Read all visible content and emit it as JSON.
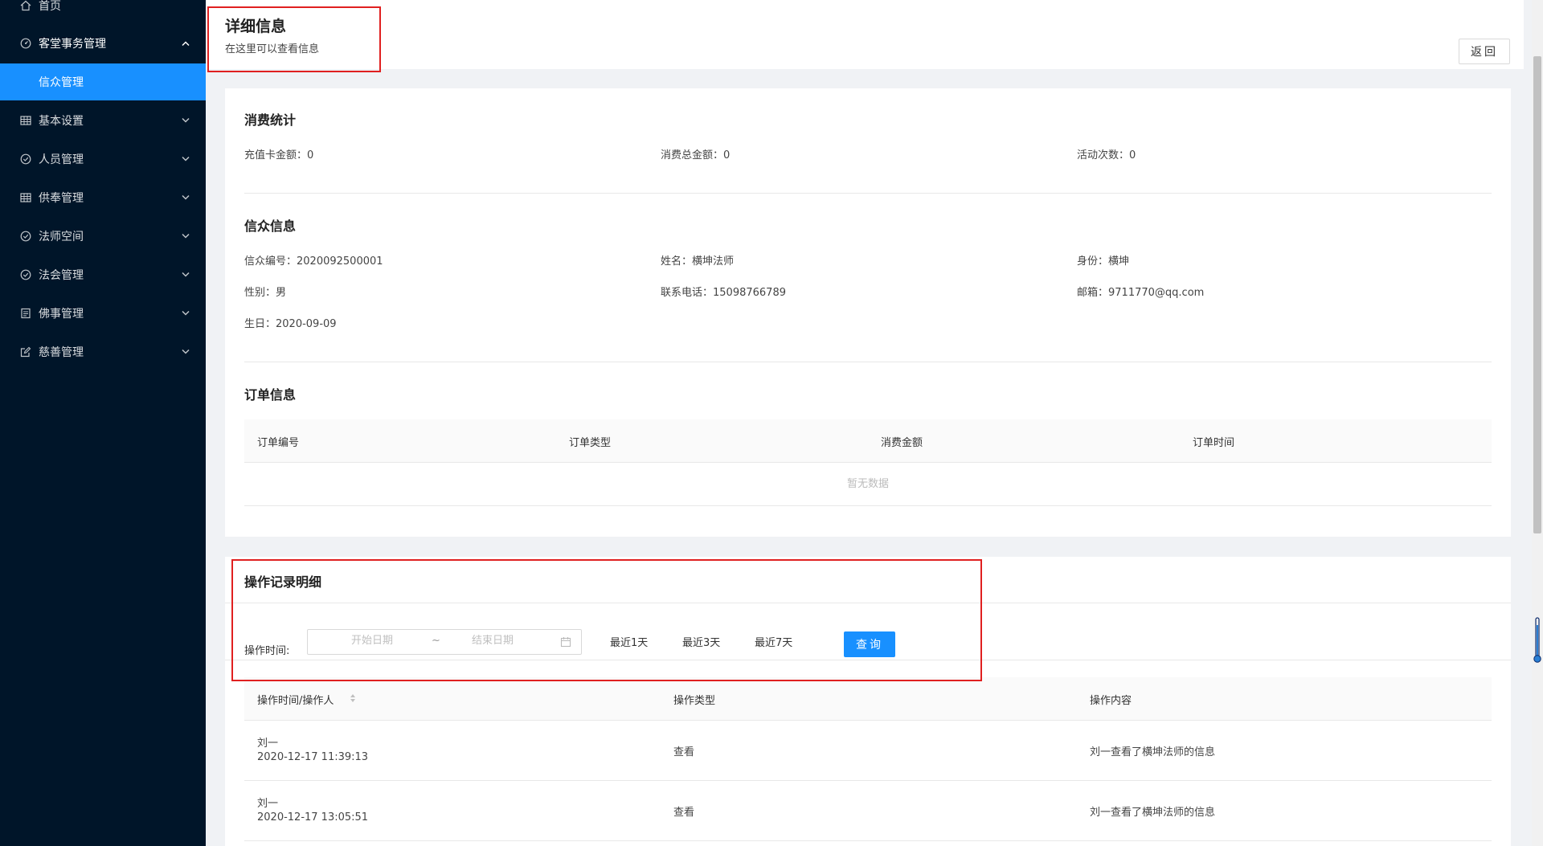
{
  "sidebar": {
    "items": [
      {
        "label": "首页",
        "icon": "home-icon"
      },
      {
        "label": "客堂事务管理",
        "icon": "dashboard-icon"
      },
      {
        "label": "信众管理"
      },
      {
        "label": "基本设置",
        "icon": "table-icon"
      },
      {
        "label": "人员管理",
        "icon": "check-circle-icon"
      },
      {
        "label": "供奉管理",
        "icon": "table-icon"
      },
      {
        "label": "法师空间",
        "icon": "check-circle-icon"
      },
      {
        "label": "法会管理",
        "icon": "check-circle-icon"
      },
      {
        "label": "佛事管理",
        "icon": "profile-icon"
      },
      {
        "label": "慈善管理",
        "icon": "form-icon"
      }
    ]
  },
  "header": {
    "title": "详细信息",
    "subtitle": "在这里可以查看信息",
    "back_label": "返回"
  },
  "consumption": {
    "title": "消费统计",
    "recharge_label": "充值卡金额：",
    "recharge_value": "0",
    "total_label": "消费总金额：",
    "total_value": "0",
    "activity_label": "活动次数：",
    "activity_value": "0"
  },
  "believer": {
    "title": "信众信息",
    "id_label": "信众编号：",
    "id_value": "2020092500001",
    "name_label": "姓名：",
    "name_value": "横坤法师",
    "identity_label": "身份：",
    "identity_value": "横坤",
    "gender_label": "性别：",
    "gender_value": "男",
    "phone_label": "联系电话：",
    "phone_value": "15098766789",
    "email_label": "邮箱：",
    "email_value": "9711770@qq.com",
    "birthday_label": "生日：",
    "birthday_value": "2020-09-09"
  },
  "orders": {
    "title": "订单信息",
    "columns": [
      "订单编号",
      "订单类型",
      "消费金额",
      "订单时间"
    ],
    "empty_text": "暂无数据"
  },
  "log": {
    "title": "操作记录明细",
    "filter_label": "操作时间:",
    "start_placeholder": "开始日期",
    "end_placeholder": "结束日期",
    "separator": "~",
    "quick": [
      "最近1天",
      "最近3天",
      "最近7天"
    ],
    "query_label": "查询",
    "columns": [
      "操作时间/操作人",
      "操作类型",
      "操作内容"
    ],
    "rows": [
      {
        "user": "刘一",
        "time": "2020-12-17 11:39:13",
        "type": "查看",
        "content": "刘一查看了横坤法师的信息"
      },
      {
        "user": "刘一",
        "time": "2020-12-17 13:05:51",
        "type": "查看",
        "content": "刘一查看了横坤法师的信息"
      }
    ]
  },
  "colors": {
    "sidebar_bg": "#001529",
    "accent": "#1890ff",
    "highlight": "#e02020"
  }
}
